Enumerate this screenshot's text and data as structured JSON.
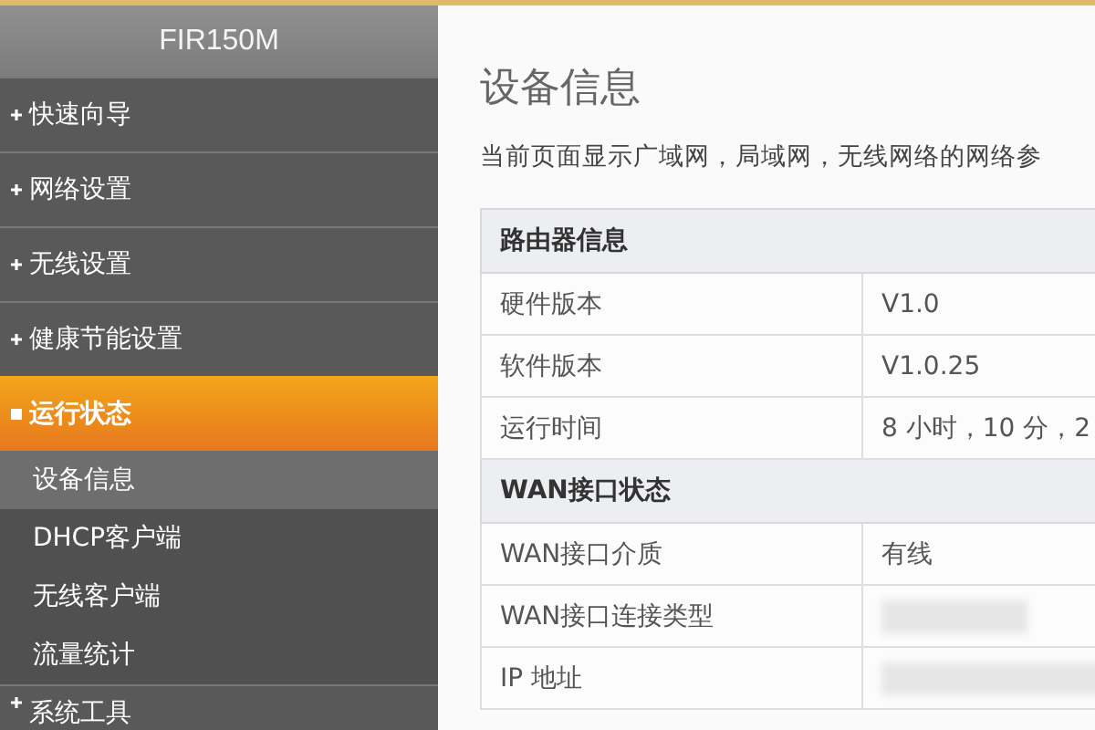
{
  "header": {
    "title": "FIR150M"
  },
  "menu": [
    {
      "label": "快速向导",
      "expanded": false,
      "selected": false
    },
    {
      "label": "网络设置",
      "expanded": false,
      "selected": false
    },
    {
      "label": "无线设置",
      "expanded": false,
      "selected": false
    },
    {
      "label": "健康节能设置",
      "expanded": false,
      "selected": false
    },
    {
      "label": "运行状态",
      "expanded": true,
      "selected": true,
      "children": [
        {
          "label": "设备信息",
          "selected": true
        },
        {
          "label": "DHCP客户端",
          "selected": false
        },
        {
          "label": "无线客户端",
          "selected": false
        },
        {
          "label": "流量统计",
          "selected": false
        }
      ]
    },
    {
      "label": "系统工具",
      "expanded": false,
      "selected": false
    }
  ],
  "page": {
    "title": "设备信息",
    "description": "当前页面显示广域网，局域网，无线网络的网络参"
  },
  "sections": [
    {
      "title": "路由器信息",
      "rows": [
        {
          "label": "硬件版本",
          "value": "V1.0",
          "blurred": false
        },
        {
          "label": "软件版本",
          "value": "V1.0.25",
          "blurred": false
        },
        {
          "label": "运行时间",
          "value": "8 小时，10 分，2",
          "blurred": false
        }
      ]
    },
    {
      "title": "WAN接口状态",
      "rows": [
        {
          "label": "WAN接口介质",
          "value": "有线",
          "blurred": false
        },
        {
          "label": "WAN接口连接类型",
          "blurred": true
        },
        {
          "label": "IP 地址",
          "blurred": true
        }
      ]
    }
  ]
}
